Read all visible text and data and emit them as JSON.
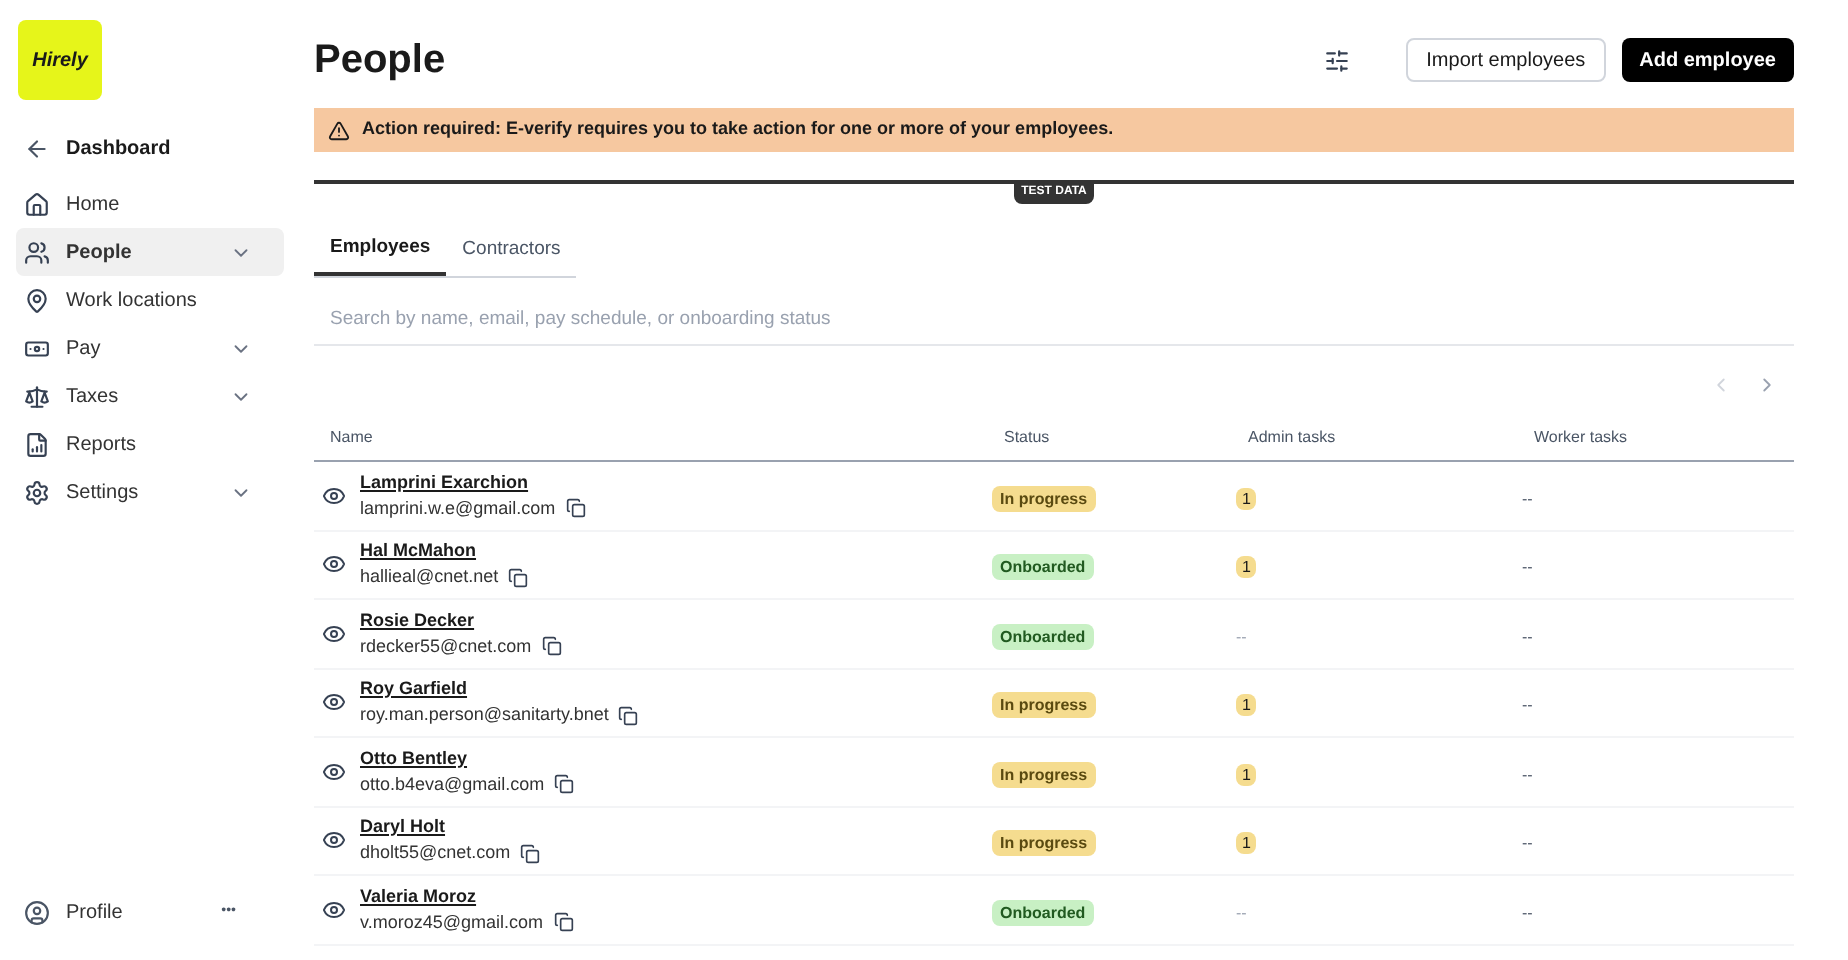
{
  "logo": {
    "text": "Hirely"
  },
  "sidebar": {
    "back": {
      "label": "Dashboard"
    },
    "items": [
      {
        "label": "Home",
        "selected": false,
        "expandable": false
      },
      {
        "label": "People",
        "selected": true,
        "expandable": true
      },
      {
        "label": "Work locations",
        "selected": false,
        "expandable": false
      },
      {
        "label": "Pay",
        "selected": false,
        "expandable": true
      },
      {
        "label": "Taxes",
        "selected": false,
        "expandable": true
      },
      {
        "label": "Reports",
        "selected": false,
        "expandable": false
      },
      {
        "label": "Settings",
        "selected": false,
        "expandable": true
      }
    ],
    "profile": {
      "label": "Profile",
      "more": "•••"
    }
  },
  "page": {
    "title": "People",
    "buttons": [
      "Import employees",
      "Add employee"
    ]
  },
  "alert": {
    "text": "Action required: E-verify requires you to take action for one or more of your employees."
  },
  "test_data": {
    "label": "TEST DATA"
  },
  "tabs": [
    {
      "label": "Employees",
      "selected": true
    },
    {
      "label": "Contractors",
      "selected": false
    }
  ],
  "search": {
    "placeholder": "Search by name, email, pay schedule, or onboarding status"
  },
  "table": {
    "columns": [
      "Name",
      "Status",
      "Admin tasks",
      "Worker tasks"
    ],
    "rows": [
      {
        "name": "Lamprini Exarchion",
        "email": "lamprini.w.e@gmail.com",
        "status": {
          "kind": "progress",
          "text": "In progress"
        },
        "admin": {
          "kind": "badge",
          "text": "1"
        },
        "worker": "--"
      },
      {
        "name": "Hal McMahon",
        "email": "hallieal@cnet.net",
        "status": {
          "kind": "done",
          "text": "Onboarded"
        },
        "admin": {
          "kind": "badge",
          "text": "1"
        },
        "worker": "--"
      },
      {
        "name": "Rosie Decker",
        "email": "rdecker55@cnet.com",
        "status": {
          "kind": "done",
          "text": "Onboarded"
        },
        "admin": {
          "kind": "empty",
          "text": "--"
        },
        "worker": "--"
      },
      {
        "name": "Roy Garfield",
        "email": "roy.man.person@sanitarty.bnet",
        "status": {
          "kind": "progress",
          "text": "In progress"
        },
        "admin": {
          "kind": "badge",
          "text": "1"
        },
        "worker": "--"
      },
      {
        "name": "Otto Bentley",
        "email": "otto.b4eva@gmail.com",
        "status": {
          "kind": "progress",
          "text": "In progress"
        },
        "admin": {
          "kind": "badge",
          "text": "1"
        },
        "worker": "--"
      },
      {
        "name": "Daryl Holt",
        "email": "dholt55@cnet.com",
        "status": {
          "kind": "progress",
          "text": "In progress"
        },
        "admin": {
          "kind": "badge",
          "text": "1"
        },
        "worker": "--"
      },
      {
        "name": "Valeria Moroz",
        "email": "v.moroz45@gmail.com",
        "status": {
          "kind": "done",
          "text": "Onboarded"
        },
        "admin": {
          "kind": "empty",
          "text": "--"
        },
        "worker": "--"
      }
    ]
  }
}
